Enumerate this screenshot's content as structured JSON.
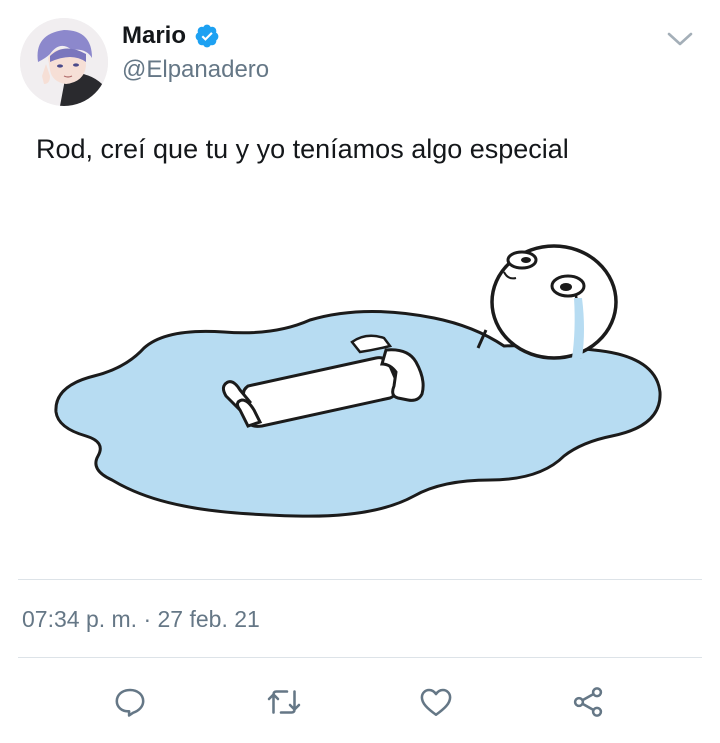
{
  "user": {
    "name": "Mario",
    "handle": "@Elpanadero",
    "verified": true
  },
  "tweet": {
    "text": "Rod, creí que tu y yo teníamos algo especial",
    "timestamp": "07:34 p. m. · 27 feb. 21"
  },
  "actions": [
    {
      "icon": "reply-icon"
    },
    {
      "icon": "retweet-icon"
    },
    {
      "icon": "like-icon"
    },
    {
      "icon": "share-icon"
    }
  ],
  "colors": {
    "verified": "#1da1f2",
    "muted": "#657786",
    "puddle": "#b7dcf2"
  }
}
